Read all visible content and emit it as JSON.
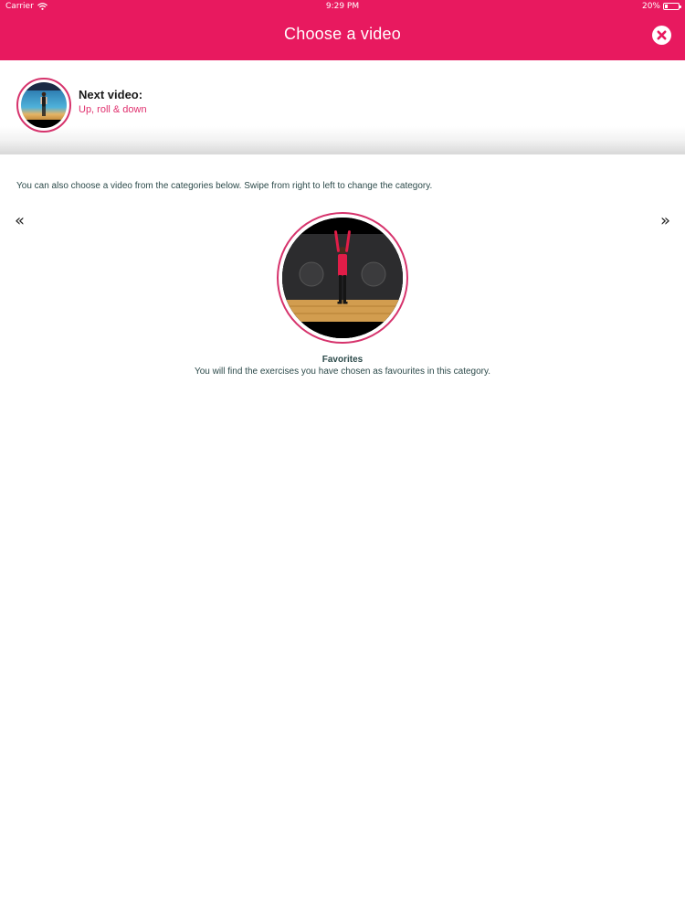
{
  "status_bar": {
    "carrier": "Carrier",
    "time": "9:29 PM",
    "battery": "20%",
    "battery_level": 0.2
  },
  "header": {
    "title": "Choose a video",
    "close_icon": "close-icon",
    "color": "#e8195f"
  },
  "next_video": {
    "heading": "Next video:",
    "name": "Up, roll & down"
  },
  "main": {
    "instructions": "You can also choose a video from the categories below. Swipe from right to left to change the category.",
    "prev_arrow": "«",
    "next_arrow": "»",
    "category": {
      "title": "Favorites",
      "description": "You will find the exercises you have chosen as favourites in this category."
    }
  },
  "colors": {
    "accent": "#e8195f",
    "ring": "#d6336c",
    "subtitle": "#e0306e",
    "text": "#2c4a4a"
  }
}
